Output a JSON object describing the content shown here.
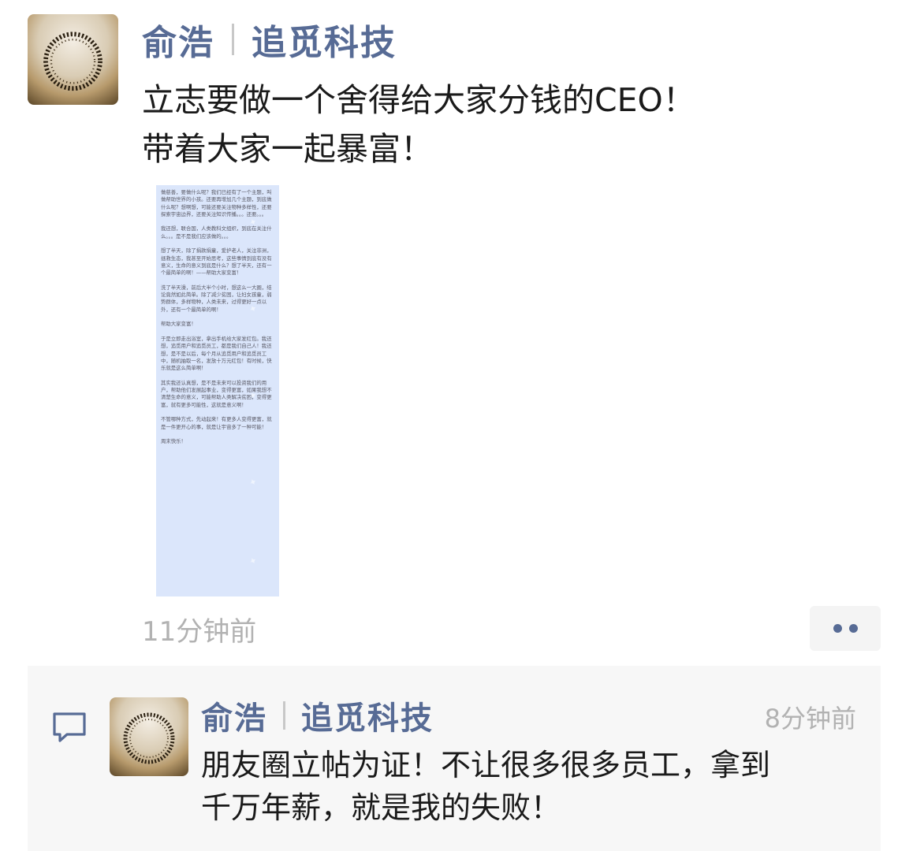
{
  "post": {
    "author_name": "俞浩",
    "author_company": "追觅科技",
    "text_lines": [
      "立志要做一个舍得给大家分钱的CEO！",
      "带着大家一起暴富！"
    ],
    "image_text": "做慈善，要做什么呢？我们已经有了一个主题，叫做帮助世界的小孩。还要再增加几个主题，到底做什么呢？想啊想，可能还要关注物种多样性，还要探索宇宙边界，还要关注知识传播。。。还要。。。\n\n我还想，联合国，人类教科文组织，到底在关注什么。。。是不是我们应该做的。。。\n\n想了半天，除了捐款捐童，爱护老人，关注非洲，拯救生态，我甚至开始思考，这些事情到底有没有意义，生命的意义到底是什么？想了半天，还有一个最简单的啊！——帮助大家变富！\n\n洗了半天澡，前后大半个小时，想这么一大圈，结论竟然如此简单。除了减少贫困，让妇女孩童，弱势群体，多样物种，人类未来，过得更好一点以外，还有一个最简单的啊！\n\n帮助大家变富！\n\n于是立即走出浴室，拿出手机给大家发红包。我还想，追觅用户和追觅员工，都是我们自己人！我还想，是不是以后，每个月从追觅用户和追觅员工中，随机抽取一名，发放十万元红包！有时候，快乐就是这么简单啊！\n\n其实我还认真想，是不是未来可以投资我们的用户，帮助他们发展起事业，变得更富，如果我想不清楚生命的意义，可能帮助人类解决贫困，变得更富，就有更多可能性，这就是意义啊！\n\n不管哪种方式，先动起来！有更多人变得更富，就是一件更开心的事，就是让宇宙多了一种可能！\n\n周末快乐！",
    "time": "11分钟前"
  },
  "comment": {
    "author_name": "俞浩",
    "author_company": "追觅科技",
    "time": "8分钟前",
    "text_lines": [
      "朋友圈立帖为证！不让很多很多员工，拿到",
      "千万年薪，就是我的失败！"
    ]
  },
  "colors": {
    "name": "#576b95",
    "text": "#1a1a1a",
    "time": "#b2b2b2",
    "comment_bg": "#f7f7f7",
    "image_bg": "#dbe6fb"
  },
  "icons": {
    "more": "more-dots-icon",
    "comment": "comment-bubble-icon"
  }
}
